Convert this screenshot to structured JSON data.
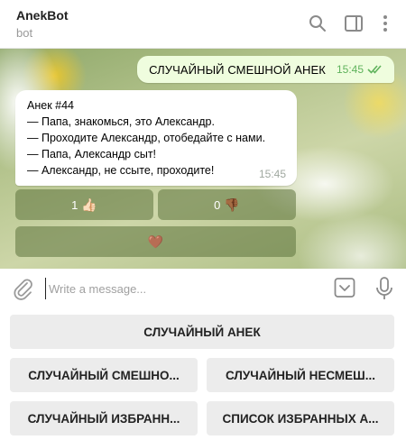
{
  "header": {
    "title": "AnekBot",
    "subtitle": "bot",
    "icons": [
      "search-icon",
      "sidebar-toggle-icon",
      "more-vert-icon"
    ]
  },
  "messages": {
    "outgoing": {
      "text": "СЛУЧАЙНЫЙ СМЕШНОЙ АНЕК",
      "time": "15:45",
      "status": "double-check-read"
    },
    "incoming": {
      "lines": [
        "Анек #44",
        "— Папа, знакомься, это Александр.",
        "— Проходите Александр, отобедайте с нами.",
        "— Папа, Александр сыт!",
        "— Александр, не ссыте, проходите!"
      ],
      "time": "15:45"
    }
  },
  "inline_keyboard": {
    "like": {
      "count": "1",
      "emoji": "👍🏻"
    },
    "dislike": {
      "count": "0",
      "emoji": "👎🏾"
    },
    "favorite": {
      "emoji": "🤎"
    }
  },
  "input": {
    "placeholder": "Write a message...",
    "value": ""
  },
  "reply_keyboard": {
    "row1": "СЛУЧАЙНЫЙ АНЕК",
    "row2": [
      "СЛУЧАЙНЫЙ СМЕШНО...",
      "СЛУЧАЙНЫЙ НЕСМЕШ..."
    ],
    "row3": [
      "СЛУЧАЙНЫЙ ИЗБРАНН...",
      "СПИСОК ИЗБРАННЫХ А..."
    ]
  },
  "colors": {
    "outgoing_bubble": "#effdde",
    "read_check": "#5fb35c",
    "inline_button": "#5c733c",
    "reply_button": "#ececec"
  }
}
